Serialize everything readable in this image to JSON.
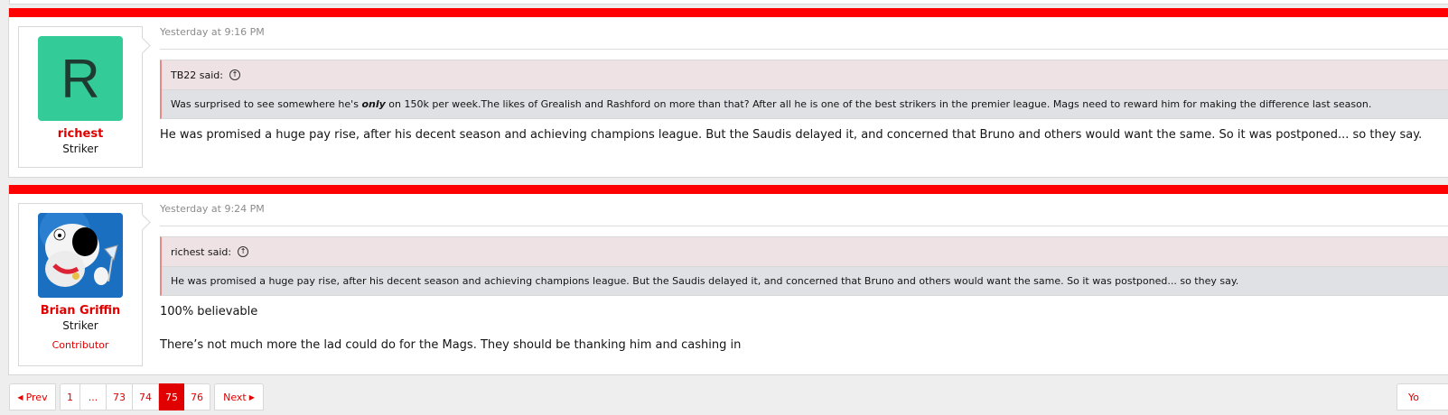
{
  "posts": [
    {
      "user": {
        "name": "richest",
        "title": "Striker",
        "avatar_letter": "R"
      },
      "date": "Yesterday at 9:16 PM",
      "quote": {
        "author": "TB22 said:",
        "text_before": "Was surprised to see somewhere he's ",
        "text_em": "only",
        "text_after": " on 150k per week.The likes of Grealish and Rashford on more than that? After all he is one of the best strikers in the premier league. Mags need to reward him for making the difference last season."
      },
      "message": "He was promised a huge pay rise, after his decent season and achieving champions league. But the Saudis delayed it, and concerned that Bruno and others would want the same. So it was postponed... so they say."
    },
    {
      "user": {
        "name": "Brian Griffin",
        "title": "Striker",
        "banner": "Contributor"
      },
      "date": "Yesterday at 9:24 PM",
      "quote": {
        "author": "richest said:",
        "text": "He was promised a huge pay rise, after his decent season and achieving champions league. But the Saudis delayed it, and concerned that Bruno and others would want the same. So it was postponed... so they say."
      },
      "message_lines": [
        "100% believable",
        "There’s not much more the lad could do for the Mags. They should be thanking him and cashing in"
      ]
    }
  ],
  "pagination": {
    "prev": "Prev",
    "pages": [
      "1",
      "...",
      "73",
      "74",
      "75",
      "76"
    ],
    "current": "75",
    "next": "Next"
  },
  "right_button": "Yo",
  "colors": {
    "accent": "#e00000",
    "redbar": "#ff0000",
    "avatar_bg": "#33cc99"
  }
}
